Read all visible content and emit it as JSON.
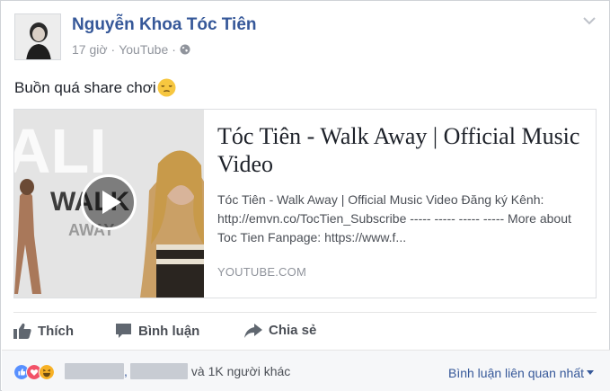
{
  "post": {
    "author": "Nguyễn Khoa Tóc Tiên",
    "time": "17 giờ",
    "separator": "·",
    "source": "YouTube",
    "message": "Buồn quá share chơi"
  },
  "link_card": {
    "title": "Tóc Tiên - Walk Away | Official Music Video",
    "description": "Tóc Tiên - Walk Away | Official Music Video Đăng ký Kênh: http://emvn.co/TocTien_Subscribe ----- ----- ----- ----- More about Toc Tien Fanpage: https://www.f...",
    "domain": "YOUTUBE.COM",
    "thumbnail_text": "WALK AWAY"
  },
  "actions": {
    "like": "Thích",
    "comment": "Bình luận",
    "share": "Chia sẻ"
  },
  "footer": {
    "names_separator": ",",
    "others": "và 1K người khác",
    "related": "Bình luận liên quan nhất"
  },
  "icons": {
    "avatar": "profile-photo",
    "globe": "globe-icon",
    "chevron": "chevron-down-icon",
    "emoji": "pensive-face-emoji",
    "play": "play-icon",
    "like": "thumbs-up-icon",
    "comment": "comment-icon",
    "share": "share-arrow-icon",
    "reactions": [
      "like-reaction-icon",
      "love-reaction-icon",
      "haha-reaction-icon"
    ]
  },
  "colors": {
    "link_blue": "#365899",
    "like_blue": "#5890ff",
    "love_red": "#f25268",
    "haha_yellow": "#f7b125"
  }
}
